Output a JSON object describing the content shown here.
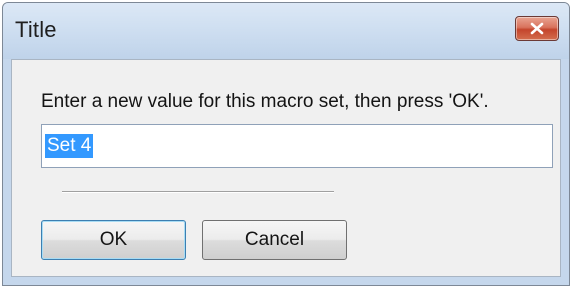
{
  "window": {
    "title": "Title",
    "close_icon": "close-icon",
    "accent_color": "#c5d7ec",
    "close_color": "#c4452c"
  },
  "dialog": {
    "prompt": "Enter a new value for this macro set, then press 'OK'.",
    "input_value": "Set 4",
    "input_selected": true,
    "selection_color": "#3399ff"
  },
  "buttons": {
    "ok_label": "OK",
    "cancel_label": "Cancel"
  }
}
